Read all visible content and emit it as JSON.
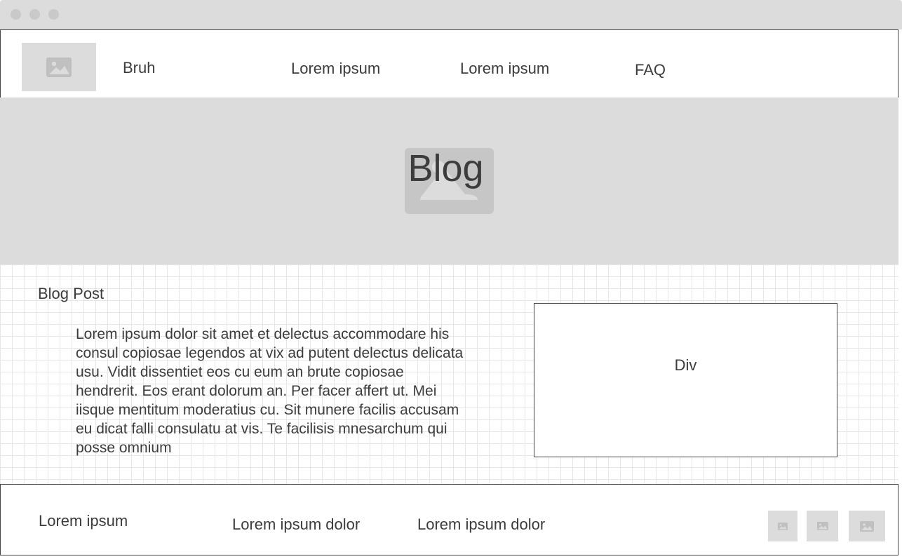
{
  "window": {
    "controls": [
      "close",
      "minimize",
      "maximize"
    ]
  },
  "navbar": {
    "logo_icon": "image-icon",
    "items": [
      {
        "label": "Bruh"
      },
      {
        "label": "Lorem ipsum"
      },
      {
        "label": "Lorem ipsum"
      },
      {
        "label": "FAQ"
      }
    ]
  },
  "hero": {
    "image_icon": "image-icon",
    "title": "Blog"
  },
  "main": {
    "post_heading": "Blog Post",
    "post_body": "Lorem ipsum dolor sit amet et delectus accommodare his consul copiosae legendos at vix ad putent delectus delicata usu. Vidit dissentiet eos cu eum an brute copiosae hendrerit. Eos erant dolorum an. Per facer affert ut. Mei iisque mentitum moderatius cu. Sit munere facilis accusam eu dicat falli consulatu at vis. Te facilisis mnesarchum qui posse omnium",
    "div_label": "Div"
  },
  "footer": {
    "items": [
      {
        "label": "Lorem ipsum"
      },
      {
        "label": "Lorem ipsum dolor"
      },
      {
        "label": "Lorem ipsum dolor"
      }
    ],
    "social_icons": [
      "image-icon",
      "image-icon",
      "image-icon"
    ]
  },
  "colors": {
    "placeholder": "#dcdcdc",
    "icon": "#c0c0c0",
    "text": "#3c3c3c",
    "border": "#444444"
  }
}
